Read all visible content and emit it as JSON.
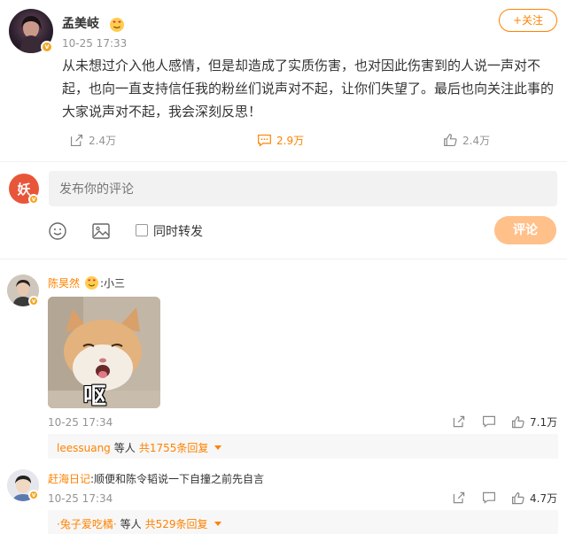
{
  "post": {
    "author": "孟美岐",
    "time": "10-25 17:33",
    "follow_label": "+关注",
    "text": "从未想过介入他人感情，但是却造成了实质伤害，也对因此伤害到的人说一声对不起，也向一直支持信任我的粉丝们说声对不起，让你们失望了。最后也向关注此事的大家说声对不起，我会深刻反思！",
    "actions": {
      "share": "2.4万",
      "comment": "2.9万",
      "like": "2.4万"
    }
  },
  "composer": {
    "placeholder": "发布你的评论",
    "repost_label": "同时转发",
    "submit_label": "评论"
  },
  "comments": [
    {
      "author": "陈昊然",
      "text": ":小三",
      "image_caption": "呕",
      "time": "10-25 17:34",
      "like_count": "7.1万",
      "reply_user": "leessuang",
      "reply_mid": "等人",
      "reply_count": "共1755条回复"
    },
    {
      "author": "赶海日记",
      "text": ":顺便和陈令韬说一下自撞之前先自言",
      "time": "10-25 17:34",
      "like_count": "4.7万",
      "reply_user": "·兔子爱吃橘·",
      "reply_mid": "等人",
      "reply_count": "共529条回复"
    }
  ],
  "colors": {
    "accent": "#ff8200",
    "muted": "#939393",
    "submit_disabled": "#ffc08a"
  }
}
